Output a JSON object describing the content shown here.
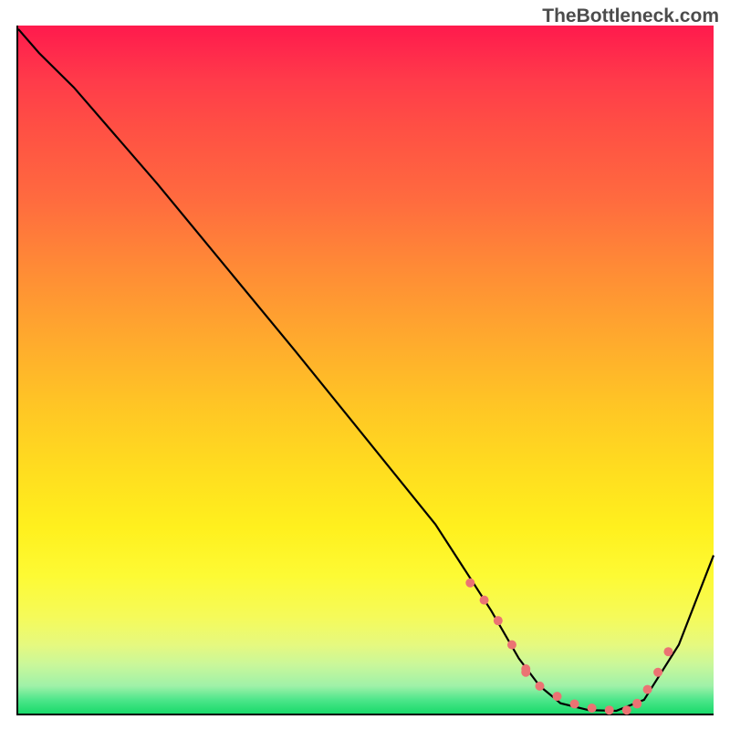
{
  "watermark": "TheBottleneck.com",
  "chart_data": {
    "type": "line",
    "title": "",
    "xlabel": "",
    "ylabel": "",
    "xlim": [
      0,
      100
    ],
    "ylim": [
      0,
      100
    ],
    "curve": {
      "x": [
        0,
        3,
        8,
        20,
        40,
        60,
        68,
        72,
        75,
        78,
        82,
        86,
        90,
        95,
        100
      ],
      "y": [
        99.5,
        96,
        91,
        77,
        52.5,
        27.5,
        15,
        8,
        4,
        1.5,
        0.5,
        0.4,
        2,
        10,
        23
      ]
    },
    "dotted_segments": [
      {
        "x": [
          65,
          67,
          69,
          71,
          73
        ],
        "y": [
          19,
          16.5,
          13.5,
          10,
          6.5
        ]
      },
      {
        "x": [
          73,
          75,
          77.5,
          80,
          82.5,
          85,
          87.5,
          89
        ],
        "y": [
          6,
          4,
          2.5,
          1.4,
          0.8,
          0.5,
          0.5,
          1.4
        ]
      },
      {
        "x": [
          89,
          90.5,
          92,
          93.5
        ],
        "y": [
          1.5,
          3.5,
          6,
          9
        ]
      }
    ],
    "colors": {
      "curve": "#000000",
      "dots": "#eb7373",
      "gradient_top": "#ff1a4d",
      "gradient_bottom": "#19da6b"
    }
  }
}
